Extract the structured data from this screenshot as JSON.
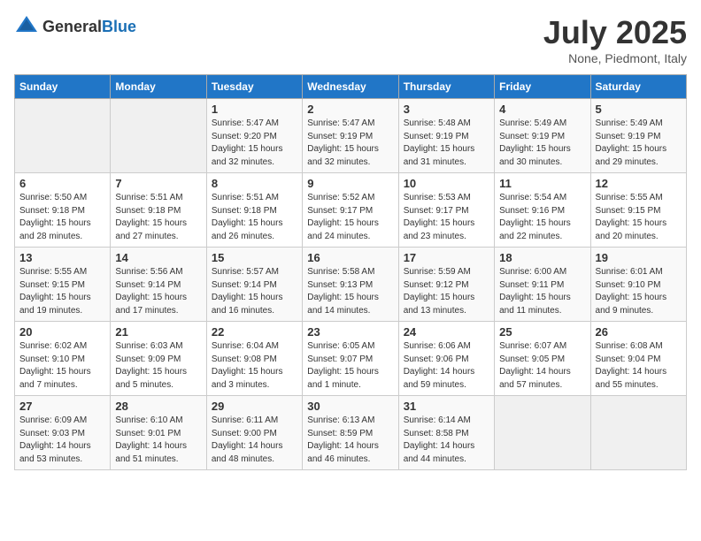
{
  "header": {
    "logo_general": "General",
    "logo_blue": "Blue",
    "month": "July 2025",
    "location": "None, Piedmont, Italy"
  },
  "weekdays": [
    "Sunday",
    "Monday",
    "Tuesday",
    "Wednesday",
    "Thursday",
    "Friday",
    "Saturday"
  ],
  "weeks": [
    [
      {
        "day": "",
        "info": ""
      },
      {
        "day": "",
        "info": ""
      },
      {
        "day": "1",
        "info": "Sunrise: 5:47 AM\nSunset: 9:20 PM\nDaylight: 15 hours and 32 minutes."
      },
      {
        "day": "2",
        "info": "Sunrise: 5:47 AM\nSunset: 9:19 PM\nDaylight: 15 hours and 32 minutes."
      },
      {
        "day": "3",
        "info": "Sunrise: 5:48 AM\nSunset: 9:19 PM\nDaylight: 15 hours and 31 minutes."
      },
      {
        "day": "4",
        "info": "Sunrise: 5:49 AM\nSunset: 9:19 PM\nDaylight: 15 hours and 30 minutes."
      },
      {
        "day": "5",
        "info": "Sunrise: 5:49 AM\nSunset: 9:19 PM\nDaylight: 15 hours and 29 minutes."
      }
    ],
    [
      {
        "day": "6",
        "info": "Sunrise: 5:50 AM\nSunset: 9:18 PM\nDaylight: 15 hours and 28 minutes."
      },
      {
        "day": "7",
        "info": "Sunrise: 5:51 AM\nSunset: 9:18 PM\nDaylight: 15 hours and 27 minutes."
      },
      {
        "day": "8",
        "info": "Sunrise: 5:51 AM\nSunset: 9:18 PM\nDaylight: 15 hours and 26 minutes."
      },
      {
        "day": "9",
        "info": "Sunrise: 5:52 AM\nSunset: 9:17 PM\nDaylight: 15 hours and 24 minutes."
      },
      {
        "day": "10",
        "info": "Sunrise: 5:53 AM\nSunset: 9:17 PM\nDaylight: 15 hours and 23 minutes."
      },
      {
        "day": "11",
        "info": "Sunrise: 5:54 AM\nSunset: 9:16 PM\nDaylight: 15 hours and 22 minutes."
      },
      {
        "day": "12",
        "info": "Sunrise: 5:55 AM\nSunset: 9:15 PM\nDaylight: 15 hours and 20 minutes."
      }
    ],
    [
      {
        "day": "13",
        "info": "Sunrise: 5:55 AM\nSunset: 9:15 PM\nDaylight: 15 hours and 19 minutes."
      },
      {
        "day": "14",
        "info": "Sunrise: 5:56 AM\nSunset: 9:14 PM\nDaylight: 15 hours and 17 minutes."
      },
      {
        "day": "15",
        "info": "Sunrise: 5:57 AM\nSunset: 9:14 PM\nDaylight: 15 hours and 16 minutes."
      },
      {
        "day": "16",
        "info": "Sunrise: 5:58 AM\nSunset: 9:13 PM\nDaylight: 15 hours and 14 minutes."
      },
      {
        "day": "17",
        "info": "Sunrise: 5:59 AM\nSunset: 9:12 PM\nDaylight: 15 hours and 13 minutes."
      },
      {
        "day": "18",
        "info": "Sunrise: 6:00 AM\nSunset: 9:11 PM\nDaylight: 15 hours and 11 minutes."
      },
      {
        "day": "19",
        "info": "Sunrise: 6:01 AM\nSunset: 9:10 PM\nDaylight: 15 hours and 9 minutes."
      }
    ],
    [
      {
        "day": "20",
        "info": "Sunrise: 6:02 AM\nSunset: 9:10 PM\nDaylight: 15 hours and 7 minutes."
      },
      {
        "day": "21",
        "info": "Sunrise: 6:03 AM\nSunset: 9:09 PM\nDaylight: 15 hours and 5 minutes."
      },
      {
        "day": "22",
        "info": "Sunrise: 6:04 AM\nSunset: 9:08 PM\nDaylight: 15 hours and 3 minutes."
      },
      {
        "day": "23",
        "info": "Sunrise: 6:05 AM\nSunset: 9:07 PM\nDaylight: 15 hours and 1 minute."
      },
      {
        "day": "24",
        "info": "Sunrise: 6:06 AM\nSunset: 9:06 PM\nDaylight: 14 hours and 59 minutes."
      },
      {
        "day": "25",
        "info": "Sunrise: 6:07 AM\nSunset: 9:05 PM\nDaylight: 14 hours and 57 minutes."
      },
      {
        "day": "26",
        "info": "Sunrise: 6:08 AM\nSunset: 9:04 PM\nDaylight: 14 hours and 55 minutes."
      }
    ],
    [
      {
        "day": "27",
        "info": "Sunrise: 6:09 AM\nSunset: 9:03 PM\nDaylight: 14 hours and 53 minutes."
      },
      {
        "day": "28",
        "info": "Sunrise: 6:10 AM\nSunset: 9:01 PM\nDaylight: 14 hours and 51 minutes."
      },
      {
        "day": "29",
        "info": "Sunrise: 6:11 AM\nSunset: 9:00 PM\nDaylight: 14 hours and 48 minutes."
      },
      {
        "day": "30",
        "info": "Sunrise: 6:13 AM\nSunset: 8:59 PM\nDaylight: 14 hours and 46 minutes."
      },
      {
        "day": "31",
        "info": "Sunrise: 6:14 AM\nSunset: 8:58 PM\nDaylight: 14 hours and 44 minutes."
      },
      {
        "day": "",
        "info": ""
      },
      {
        "day": "",
        "info": ""
      }
    ]
  ]
}
